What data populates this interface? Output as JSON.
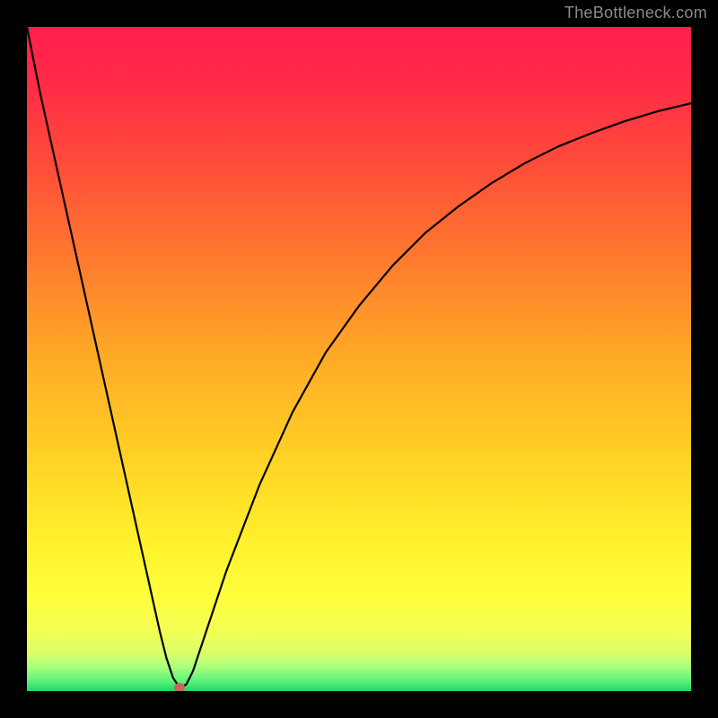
{
  "attribution": "TheBottleneck.com",
  "chart_data": {
    "type": "line",
    "title": "",
    "xlabel": "",
    "ylabel": "",
    "xlim": [
      0,
      100
    ],
    "ylim": [
      0,
      100
    ],
    "series": [
      {
        "name": "bottleneck-curve",
        "x": [
          0,
          2,
          4,
          6,
          8,
          10,
          12,
          14,
          16,
          18,
          20,
          21,
          22,
          23,
          24,
          25,
          27,
          30,
          35,
          40,
          45,
          50,
          55,
          60,
          65,
          70,
          75,
          80,
          85,
          90,
          95,
          100
        ],
        "values": [
          100,
          90,
          81,
          72,
          63,
          54,
          45,
          36,
          27,
          18,
          9,
          5,
          2,
          0.5,
          1,
          3,
          9,
          18,
          31,
          42,
          51,
          58,
          64,
          69,
          73,
          76.5,
          79.5,
          82,
          84,
          85.8,
          87.3,
          88.5
        ]
      }
    ],
    "optimum_marker": {
      "x": 23,
      "y": 0.5,
      "color": "#c9625c"
    },
    "background_gradient_stops": [
      {
        "pos": 0.0,
        "color": "#ff1f4d"
      },
      {
        "pos": 0.08,
        "color": "#ff2a47"
      },
      {
        "pos": 0.2,
        "color": "#ff4a3a"
      },
      {
        "pos": 0.35,
        "color": "#ff7a2e"
      },
      {
        "pos": 0.5,
        "color": "#ffab26"
      },
      {
        "pos": 0.65,
        "color": "#ffd226"
      },
      {
        "pos": 0.78,
        "color": "#fff22b"
      },
      {
        "pos": 0.86,
        "color": "#ffff3e"
      },
      {
        "pos": 0.91,
        "color": "#f4ff55"
      },
      {
        "pos": 0.945,
        "color": "#d6ff6a"
      },
      {
        "pos": 0.965,
        "color": "#a6ff7e"
      },
      {
        "pos": 0.985,
        "color": "#5cf27a"
      },
      {
        "pos": 1.0,
        "color": "#1fd66a"
      }
    ]
  }
}
